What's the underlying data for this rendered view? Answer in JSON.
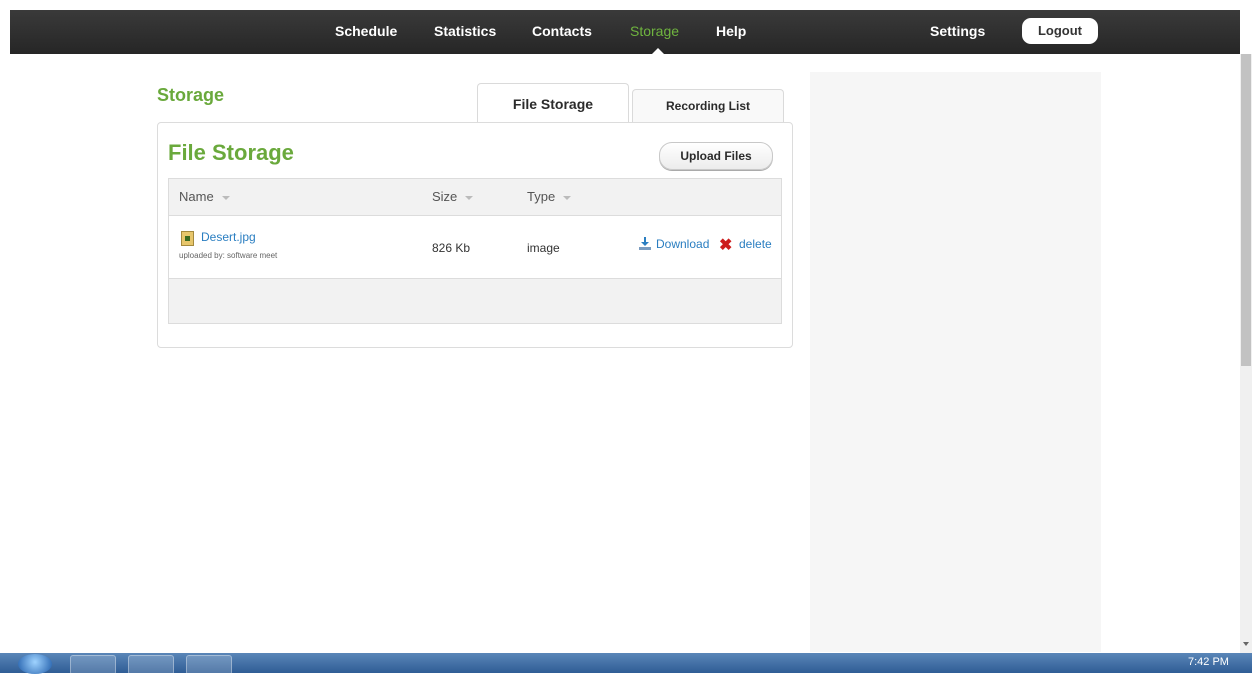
{
  "nav": {
    "items": [
      "Schedule",
      "Statistics",
      "Contacts",
      "Storage",
      "Help"
    ],
    "active": "Storage",
    "settings": "Settings",
    "logout": "Logout"
  },
  "page": {
    "title": "Storage",
    "tabs": [
      "File Storage",
      "Recording List"
    ],
    "active_tab": "File Storage"
  },
  "panel": {
    "title": "File Storage",
    "upload_button": "Upload Files",
    "columns": [
      "Name",
      "Size",
      "Type"
    ],
    "rows": [
      {
        "name": "Desert.jpg",
        "uploaded_by": "uploaded by: software meet",
        "size": "826 Kb",
        "type": "image",
        "download": "Download",
        "delete": "delete"
      }
    ]
  },
  "taskbar": {
    "clock": "7:42 PM"
  },
  "colors": {
    "accent": "#6aa93c",
    "link": "#2a7ec1",
    "nav_bg": "#2f2f2f"
  }
}
